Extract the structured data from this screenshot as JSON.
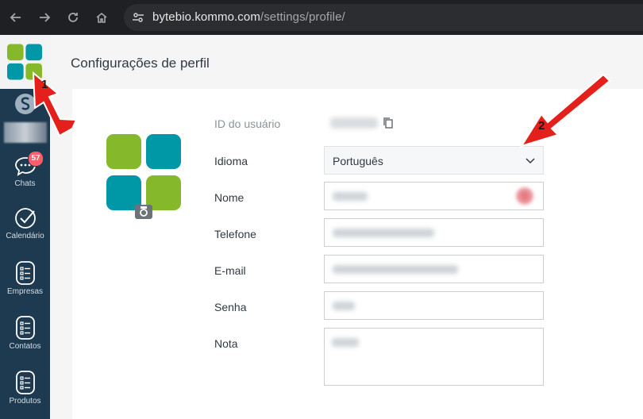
{
  "browser": {
    "url_host": "bytebio.kommo.com",
    "url_path": "/settings/profile/"
  },
  "sidebar": {
    "items": [
      {
        "label": "Chats",
        "icon": "chat-bubble-icon",
        "badge": "57"
      },
      {
        "label": "Calendário",
        "icon": "check-circle-icon"
      },
      {
        "label": "Empresas",
        "icon": "list-doc-icon"
      },
      {
        "label": "Contatos",
        "icon": "list-doc-icon"
      },
      {
        "label": "Produtos",
        "icon": "list-doc-icon"
      }
    ]
  },
  "page": {
    "title": "Configurações de perfil"
  },
  "form": {
    "user_id_label": "ID do usuário",
    "language_label": "Idioma",
    "language_value": "Português",
    "name_label": "Nome",
    "phone_label": "Telefone",
    "email_label": "E-mail",
    "password_label": "Senha",
    "note_label": "Nota"
  },
  "annotations": {
    "marker_1": "1",
    "marker_2": "2"
  },
  "colors": {
    "sidebar_bg": "#1e3a50",
    "logo_green": "#86b82b",
    "logo_teal": "#0097a7",
    "arrow_red": "#e3201b",
    "badge_red": "#ff5d69"
  }
}
